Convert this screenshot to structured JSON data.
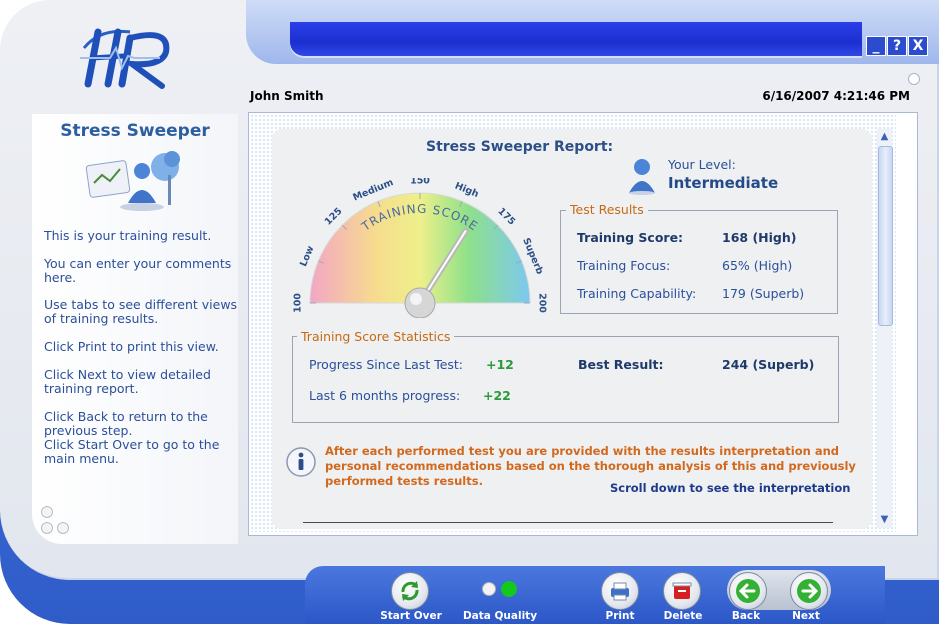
{
  "app": {
    "logo_text": "HR"
  },
  "window_buttons": {
    "minimize": "_",
    "help": "?",
    "close": "X"
  },
  "header": {
    "user_name": "John Smith",
    "datetime": "6/16/2007 4:21:46 PM"
  },
  "sidebar": {
    "title": "Stress Sweeper",
    "help_lines": [
      "This is your training result.",
      "You can enter your comments here.",
      "Use tabs to see different views of training results.",
      "Click Print to print this view.",
      "Click Next to view detailed training report.",
      "Click Back to return to the previous step.",
      "Click Start Over to go to the main menu."
    ]
  },
  "report": {
    "title": "Stress Sweeper Report:",
    "level_label": "Your Level:",
    "level_value": "Intermediate",
    "gauge": {
      "arc_label": "TRAINING SCORE",
      "ticks": [
        "100",
        "Low",
        "125",
        "Medium",
        "150",
        "High",
        "175",
        "Superb",
        "200"
      ],
      "min": 100,
      "max": 200,
      "value": 168
    },
    "test_results": {
      "title": "Test Results",
      "rows": [
        {
          "label": "Training Score:",
          "value": "168 (High)"
        },
        {
          "label": "Training Focus:",
          "value": "65% (High)"
        },
        {
          "label": "Training Capability:",
          "value": "179 (Superb)"
        }
      ]
    },
    "statistics": {
      "title": "Training Score Statistics",
      "progress_label": "Progress Since Last Test:",
      "progress_value": "+12",
      "best_label": "Best Result:",
      "best_value": "244 (Superb)",
      "six_month_label": "Last 6 months progress:",
      "six_month_value": "+22"
    },
    "info_text": "After each performed test  you are provided with the results interpretation and personal recommendations based on the thorough analysis of this and previously performed tests results.",
    "scroll_link": "Scroll down to see the interpretation"
  },
  "toolbar": {
    "start_over": "Start Over",
    "data_quality": "Data Quality",
    "print": "Print",
    "delete": "Delete",
    "back": "Back",
    "next": "Next"
  },
  "colors": {
    "accent_blue": "#2d5fa0",
    "orange": "#d2691e",
    "green": "#2a9b3a",
    "frame_blue": "#3f6fd8"
  }
}
